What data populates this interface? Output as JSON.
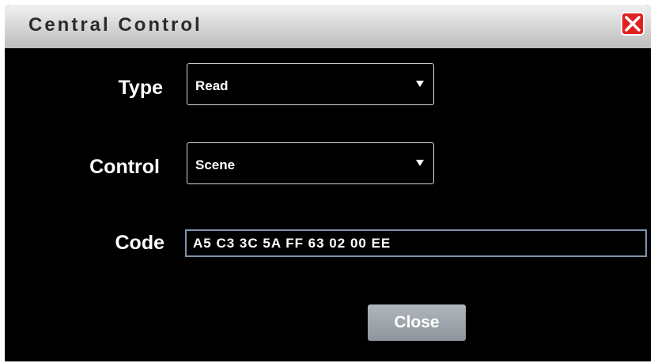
{
  "window": {
    "title": "Central Control"
  },
  "form": {
    "type_label": "Type",
    "type_value": "Read",
    "control_label": "Control",
    "control_value": "Scene",
    "code_label": "Code",
    "code_value": "A5 C3 3C 5A FF 63 02 00 EE"
  },
  "buttons": {
    "close_label": "Close"
  },
  "icons": {
    "window_close": "close-x-icon",
    "dropdown": "chevron-down-icon"
  },
  "colors": {
    "background": "#000000",
    "close_icon": "#e02020",
    "input_border": "#7d93aa"
  }
}
